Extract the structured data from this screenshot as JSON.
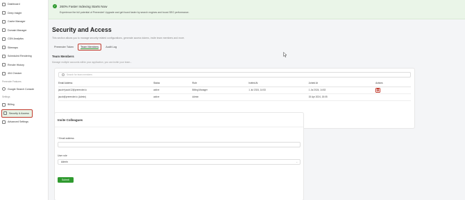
{
  "sidebar": {
    "items": [
      {
        "label": "Dashboard"
      },
      {
        "label": "Deep Insight"
      },
      {
        "label": "Cache Manager"
      },
      {
        "label": "Domain Manager"
      },
      {
        "label": "CDN Analytics"
      },
      {
        "label": "Sitemaps"
      },
      {
        "label": "Scheduled Rendering"
      },
      {
        "label": "Render History"
      },
      {
        "label": "404 Checker"
      }
    ],
    "integrations_section": "Prerender Features",
    "integrations": [
      {
        "label": "Google Search Console"
      }
    ],
    "settings_section": "Settings",
    "settings": [
      {
        "label": "Billing"
      },
      {
        "label": "Security & Access"
      },
      {
        "label": "Advanced Settings"
      }
    ]
  },
  "banner": {
    "title": "260% Faster Indexing Starts Now",
    "subtitle": "Experience the full potential of Prerender! Upgrade and get found faster by search engines and boost SEO performance."
  },
  "page": {
    "title": "Security and Access",
    "description": "This section allows you to manage security related configurations, generate access tokens, invite team members and more.",
    "tabs": [
      "Prerender Token",
      "Team Members",
      "Audit Log"
    ]
  },
  "team_members": {
    "title": "Team Members",
    "description": "Manage multiple accounts within your application, you can invite your team...",
    "search_placeholder": "Search for team members",
    "columns": [
      "Email Address",
      "Status",
      "Role",
      "Invited At",
      "Joined At",
      "Actions"
    ],
    "rows": [
      {
        "email": "jacob+jacob12@prerender.io",
        "status": "active",
        "role": "Billing Manager",
        "invited": "1 Jul 2024, 14:53",
        "joined": "1 Jul 2024, 14:53"
      },
      {
        "email": "jacob@prerender.io (Admin)",
        "status": "active",
        "role": "Admin",
        "invited": "",
        "joined": "15 Apr 2024, 15:05"
      }
    ]
  },
  "invite": {
    "title": "Invite Colleagues",
    "email_label": "* Email address",
    "email_value": "",
    "role_label": "User role",
    "role_value": "Admin",
    "submit_label": "Submit"
  },
  "colors": {
    "accent": "#2f9a2f",
    "highlight": "#c0392b"
  }
}
